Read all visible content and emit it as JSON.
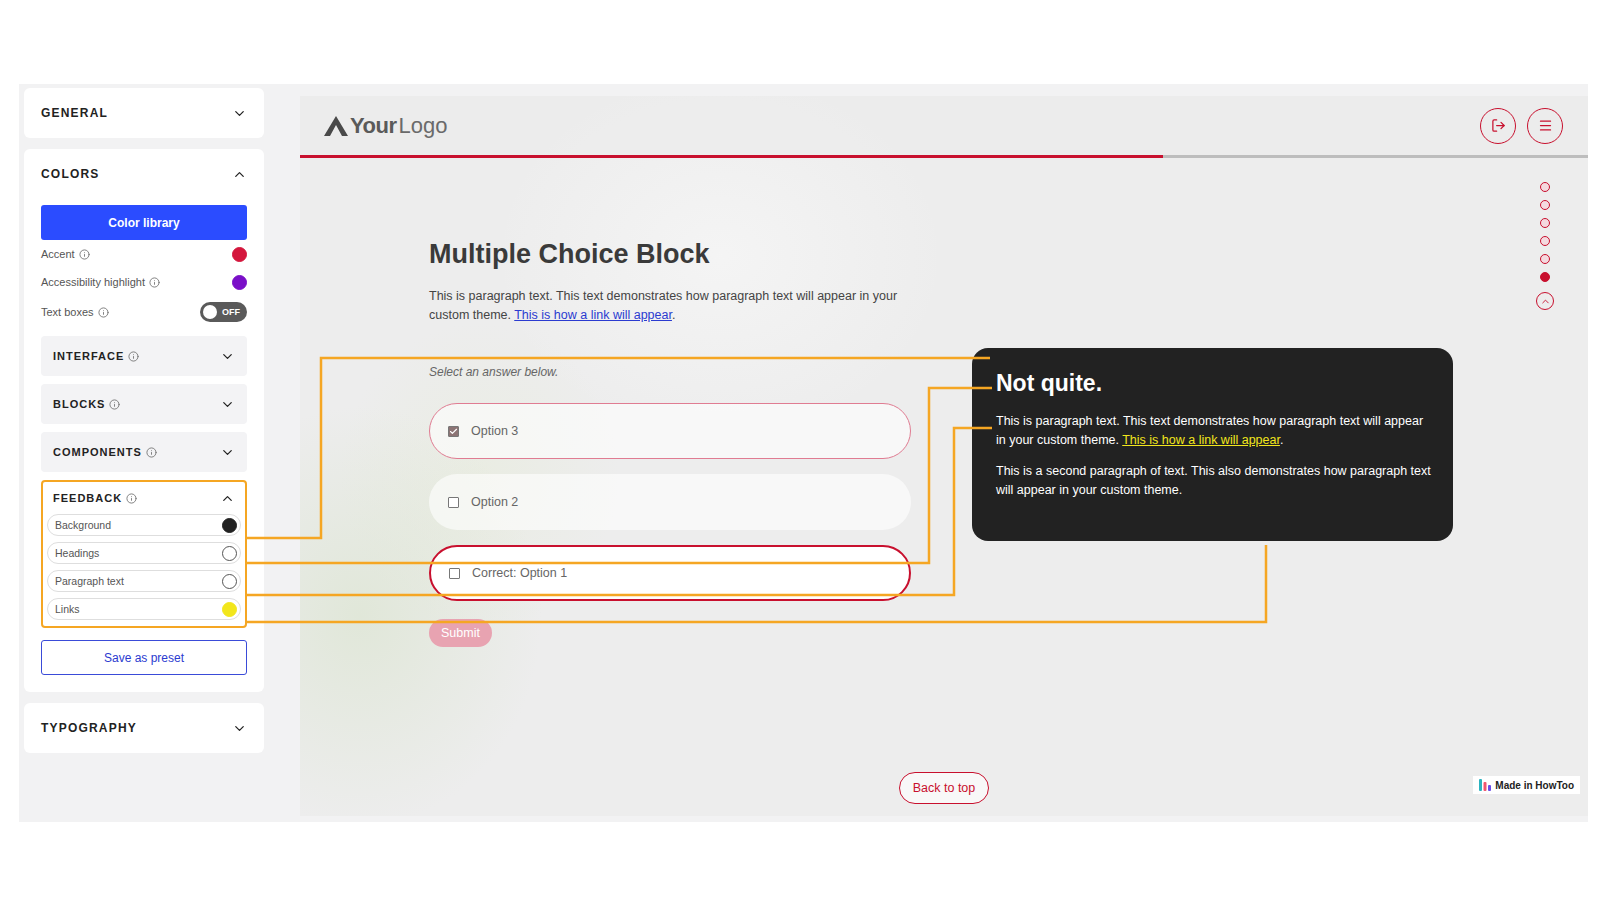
{
  "sidebar": {
    "sections": [
      {
        "label": "GENERAL",
        "expanded": false
      },
      {
        "label": "COLORS",
        "expanded": true
      },
      {
        "label": "TYPOGRAPHY",
        "expanded": false
      }
    ],
    "colors": {
      "library_button": "Color library",
      "swatches": [
        {
          "label": "Accent",
          "color": "#d4163c"
        },
        {
          "label": "Accessibility highlight",
          "color": "#7a0fc8"
        }
      ],
      "toggle": {
        "label": "Text boxes",
        "on": false,
        "state_text": "OFF"
      },
      "groups": [
        {
          "label": "INTERFACE",
          "expanded": false,
          "highlighted": false
        },
        {
          "label": "BLOCKS",
          "expanded": false,
          "highlighted": false
        },
        {
          "label": "COMPONENTS",
          "expanded": false,
          "highlighted": false
        },
        {
          "label": "FEEDBACK",
          "expanded": true,
          "highlighted": true
        }
      ],
      "feedback_items": [
        {
          "label": "Background",
          "color": "#222222"
        },
        {
          "label": "Headings",
          "color": "#ffffff"
        },
        {
          "label": "Paragraph text",
          "color": "#ffffff"
        },
        {
          "label": "Links",
          "color": "#f2e61c"
        }
      ],
      "save_button": "Save as preset"
    }
  },
  "preview": {
    "logo": {
      "bold": "Your",
      "light": "Logo"
    },
    "progress": {
      "level": 0.67
    },
    "title": "Multiple Choice Block",
    "paragraph": {
      "text": "This is paragraph text. This text demonstrates how paragraph text will appear in your custom theme.",
      "link": "This is how a link will appear",
      "after": "."
    },
    "prompt": "Select an answer below.",
    "options": [
      {
        "label": "Option 3",
        "checked": true,
        "selected": true,
        "correct": false
      },
      {
        "label": "Option 2",
        "checked": false,
        "selected": false,
        "correct": false
      },
      {
        "label": "Correct: Option 1",
        "checked": false,
        "selected": false,
        "correct": true
      }
    ],
    "submit": {
      "label": "Submit",
      "disabled": true
    },
    "feedback": {
      "heading": "Not quite.",
      "paragraphs": [
        {
          "text": "This is paragraph text. This text demonstrates how paragraph text will appear in your custom theme.",
          "link": "This is how a link will appear",
          "after": "."
        },
        {
          "text": "This is a second paragraph of text. This also demonstrates how paragraph text will appear in your custom theme."
        }
      ]
    },
    "nav_dots": [
      {
        "selected": false
      },
      {
        "selected": false
      },
      {
        "selected": false
      },
      {
        "selected": false
      },
      {
        "selected": false
      },
      {
        "selected": true
      }
    ],
    "back_to_top": "Back to top",
    "badge": "Made in HowToo"
  }
}
